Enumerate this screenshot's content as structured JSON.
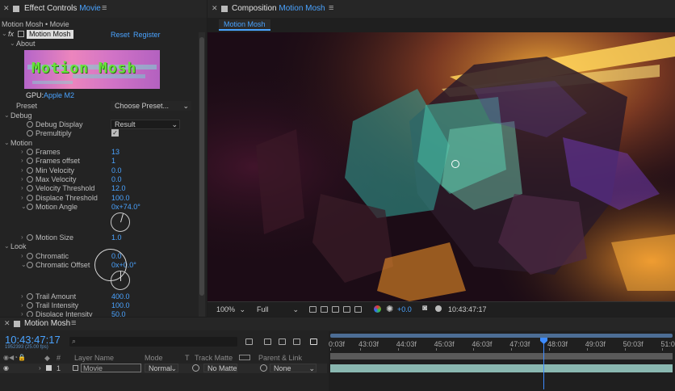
{
  "effect_controls": {
    "title": "Effect Controls",
    "title_target": "Movie",
    "breadcrumb": "Motion Mosh • Movie",
    "effect_badge": "fx",
    "effect_name": "Motion Mosh",
    "reset": "Reset",
    "register": "Register",
    "about": "About",
    "logo_text": "Motion Mosh",
    "gpu_label": "GPU:",
    "gpu_value": "Apple M2",
    "preset_label": "Preset",
    "preset_value": "Choose Preset...",
    "debug_label": "Debug",
    "debug_display_label": "Debug Display",
    "debug_display_value": "Result",
    "premultiply_label": "Premultiply",
    "motion_label": "Motion",
    "motion_params": [
      {
        "name": "Frames",
        "value": "13"
      },
      {
        "name": "Frames offset",
        "value": "1"
      },
      {
        "name": "Min Velocity",
        "value": "0.0"
      },
      {
        "name": "Max Velocity",
        "value": "0.0"
      },
      {
        "name": "Velocity Threshold",
        "value": "12.0"
      },
      {
        "name": "Displace Threshold",
        "value": "100.0"
      }
    ],
    "motion_angle_label": "Motion Angle",
    "motion_angle_value": "0x+74.0°",
    "motion_size_label": "Motion Size",
    "motion_size_value": "1.0",
    "look_label": "Look",
    "chromatic_label": "Chromatic",
    "chromatic_value": "0.0",
    "chromatic_offset_label": "Chromatic Offset",
    "chromatic_offset_value": "0x+0.0°",
    "trail_amount_label": "Trail Amount",
    "trail_amount_value": "400.0",
    "trail_intensity_label": "Trail Intensity",
    "trail_intensity_value": "100.0",
    "displace_intensity_label": "Displace Intensity",
    "displace_intensity_value": "50.0"
  },
  "composition": {
    "title": "Composition",
    "title_target": "Motion Mosh",
    "tab": "Motion Mosh",
    "zoom": "100%",
    "quality": "Full",
    "exposure": "+0.0",
    "timecode": "10:43:47:17"
  },
  "timeline": {
    "tab": "Motion Mosh",
    "timecode": "10:43:47:17",
    "timecode_sub": "1952393 (25.00 fps)",
    "search_placeholder": "",
    "headers": {
      "layer_name": "Layer Name",
      "mode": "Mode",
      "t": "T",
      "track_matte": "Track Matte",
      "parent": "Parent & Link"
    },
    "ruler": [
      "0:03f",
      "43:03f",
      "44:03f",
      "45:03f",
      "46:03f",
      "47:03f",
      "48:03f",
      "49:03f",
      "50:03f",
      "51:0"
    ],
    "playhead_fraction": 0.62,
    "layer": {
      "number": "1",
      "name": "Movie",
      "mode": "Normal",
      "matte": "No Matte",
      "parent": "None"
    }
  },
  "colors": {
    "accent": "#4aa3ff",
    "logo_green": "#67e23a",
    "playhead": "#3d8bff"
  }
}
